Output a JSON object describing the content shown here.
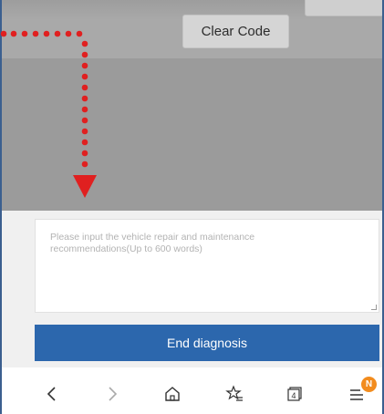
{
  "toolbar": {
    "clear_code_label": "Clear Code"
  },
  "recommendation": {
    "placeholder": "Please input the vehicle repair and maintenance recommendations(Up to 600 words)"
  },
  "actions": {
    "end_diagnosis_label": "End diagnosis"
  },
  "bottom_nav": {
    "items": [
      {
        "icon": "back-chevron-icon"
      },
      {
        "icon": "forward-chevron-icon"
      },
      {
        "icon": "home-icon"
      },
      {
        "icon": "favorite-star-icon"
      },
      {
        "icon": "tabs-icon",
        "count": "4"
      },
      {
        "icon": "menu-icon",
        "badge": "N"
      }
    ]
  },
  "colors": {
    "primary_button": "#2c67ad",
    "overlay_gray": "#9b9b9b",
    "annotation_red": "#e02020",
    "badge_orange": "#f28c1e"
  }
}
